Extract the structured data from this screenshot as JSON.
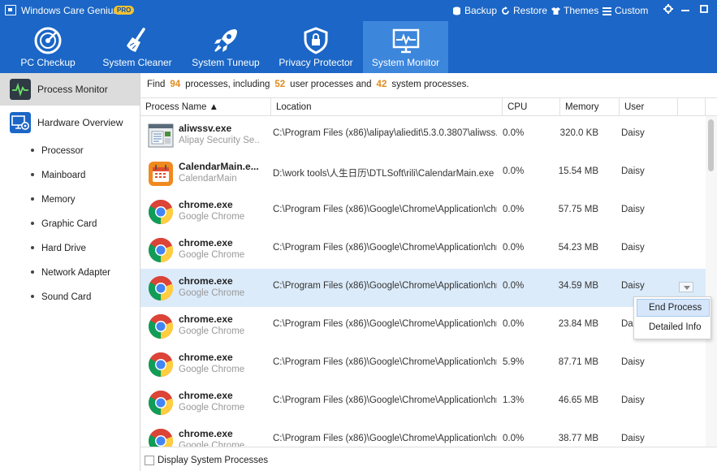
{
  "app": {
    "title": "Windows Care Genius",
    "badge": "PRO",
    "actions": [
      {
        "label": "Backup",
        "icon": "backup-icon"
      },
      {
        "label": "Restore",
        "icon": "restore-icon"
      },
      {
        "label": "Themes",
        "icon": "themes-shirt-icon"
      },
      {
        "label": "Custom",
        "icon": "custom-menu-icon"
      }
    ],
    "window_controls": {
      "settings": "gear-icon",
      "minimize": "minimize-icon",
      "maximize": "maximize-icon",
      "close": "close-icon"
    }
  },
  "toolbar": {
    "tools": [
      {
        "label": "PC Checkup",
        "icon": "radar-icon"
      },
      {
        "label": "System Cleaner",
        "icon": "broom-icon"
      },
      {
        "label": "System Tuneup",
        "icon": "rocket-icon"
      },
      {
        "label": "Privacy Protector",
        "icon": "shield-lock-icon"
      },
      {
        "label": "System Monitor",
        "icon": "monitor-pulse-icon",
        "active": true
      }
    ]
  },
  "sidebar": {
    "main": [
      {
        "label": "Process Monitor",
        "icon": "pulse-icon",
        "active": true
      },
      {
        "label": "Hardware Overview",
        "icon": "hardware-gear-icon"
      }
    ],
    "sub": [
      "Processor",
      "Mainboard",
      "Memory",
      "Graphic Card",
      "Hard Drive",
      "Network Adapter",
      "Sound Card"
    ]
  },
  "summary": {
    "prefix": "Find",
    "total": "94",
    "mid1": "processes, including",
    "user": "52",
    "mid2": "user processes and",
    "system": "42",
    "suffix": "system processes."
  },
  "columns": {
    "name": "Process Name ▲",
    "location": "Location",
    "cpu": "CPU",
    "memory": "Memory",
    "user": "User"
  },
  "processes": [
    {
      "name": "aliwssv.exe",
      "desc": "Alipay Security Se...",
      "location": "C:\\Program Files (x86)\\alipay\\aliedit\\5.3.0.3807\\aliwss...",
      "cpu": "0.0%",
      "memory": "320.0 KB",
      "user": "Daisy",
      "icon": "alipay-app-icon"
    },
    {
      "name": "CalendarMain.e...",
      "desc": "CalendarMain",
      "location": "D:\\work tools\\人生日历\\DTLSoft\\rili\\CalendarMain.exe",
      "cpu": "0.0%",
      "memory": "15.54 MB",
      "user": "Daisy",
      "icon": "calendar-app-icon"
    },
    {
      "name": "chrome.exe",
      "desc": "Google Chrome",
      "location": "C:\\Program Files (x86)\\Google\\Chrome\\Application\\chr...",
      "cpu": "0.0%",
      "memory": "57.75 MB",
      "user": "Daisy",
      "icon": "chrome-icon"
    },
    {
      "name": "chrome.exe",
      "desc": "Google Chrome",
      "location": "C:\\Program Files (x86)\\Google\\Chrome\\Application\\chr...",
      "cpu": "0.0%",
      "memory": "54.23 MB",
      "user": "Daisy",
      "icon": "chrome-icon"
    },
    {
      "name": "chrome.exe",
      "desc": "Google Chrome",
      "location": "C:\\Program Files (x86)\\Google\\Chrome\\Application\\chr...",
      "cpu": "0.0%",
      "memory": "34.59 MB",
      "user": "Daisy",
      "icon": "chrome-icon",
      "selected": true
    },
    {
      "name": "chrome.exe",
      "desc": "Google Chrome",
      "location": "C:\\Program Files (x86)\\Google\\Chrome\\Application\\chr...",
      "cpu": "0.0%",
      "memory": "23.84 MB",
      "user": "Dai",
      "icon": "chrome-icon"
    },
    {
      "name": "chrome.exe",
      "desc": "Google Chrome",
      "location": "C:\\Program Files (x86)\\Google\\Chrome\\Application\\chr...",
      "cpu": "5.9%",
      "memory": "87.71 MB",
      "user": "Daisy",
      "icon": "chrome-icon"
    },
    {
      "name": "chrome.exe",
      "desc": "Google Chrome",
      "location": "C:\\Program Files (x86)\\Google\\Chrome\\Application\\chr...",
      "cpu": "1.3%",
      "memory": "46.65 MB",
      "user": "Daisy",
      "icon": "chrome-icon"
    },
    {
      "name": "chrome.exe",
      "desc": "Google Chrome",
      "location": "C:\\Program Files (x86)\\Google\\Chrome\\Application\\chr...",
      "cpu": "0.0%",
      "memory": "38.77 MB",
      "user": "Daisy",
      "icon": "chrome-icon"
    }
  ],
  "context_menu": {
    "items": [
      "End Process",
      "Detailed Info"
    ]
  },
  "footer": {
    "checkbox_label": "Display System Processes",
    "checked": false
  },
  "colors": {
    "brand": "#1b66c6",
    "active_tab": "#3c86dc",
    "count_accent": "#e08a1c",
    "selected_row": "#dcebfa"
  }
}
